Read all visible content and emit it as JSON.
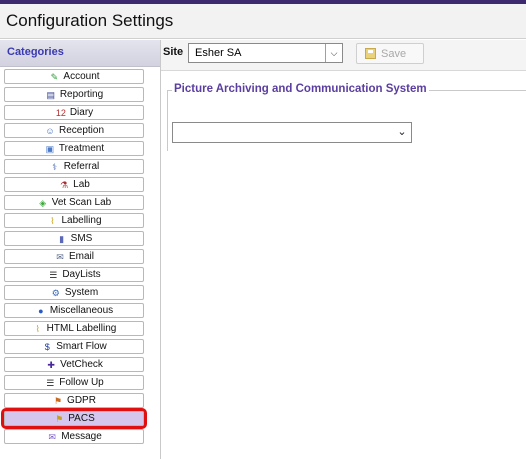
{
  "window": {
    "title": "Configuration Settings"
  },
  "sidebar": {
    "header": "Categories",
    "items": [
      {
        "label": "Account",
        "icon": "account-icon",
        "glyph": "✎",
        "color": "#2e9a3a"
      },
      {
        "label": "Reporting",
        "icon": "reporting-icon",
        "glyph": "▤",
        "color": "#2e3f8f"
      },
      {
        "label": "Diary",
        "icon": "diary-icon",
        "glyph": "12",
        "color": "#b23030"
      },
      {
        "label": "Reception",
        "icon": "reception-icon",
        "glyph": "☺",
        "color": "#3c6cc0"
      },
      {
        "label": "Treatment",
        "icon": "treatment-icon",
        "glyph": "▣",
        "color": "#4a7ac8"
      },
      {
        "label": "Referral",
        "icon": "referral-icon",
        "glyph": "⚕",
        "color": "#3c5cb0"
      },
      {
        "label": "Lab",
        "icon": "lab-icon",
        "glyph": "⚗",
        "color": "#a83030"
      },
      {
        "label": "Vet Scan Lab",
        "icon": "vet-scan-lab-icon",
        "glyph": "◈",
        "color": "#3ca83c"
      },
      {
        "label": "Labelling",
        "icon": "labelling-icon",
        "glyph": "⌇",
        "color": "#c8a020"
      },
      {
        "label": "SMS",
        "icon": "sms-icon",
        "glyph": "▮",
        "color": "#5a6ab8"
      },
      {
        "label": "Email",
        "icon": "email-icon",
        "glyph": "✉",
        "color": "#5a6a8a"
      },
      {
        "label": "DayLists",
        "icon": "daylists-icon",
        "glyph": "☰",
        "color": "#2a2a2a"
      },
      {
        "label": "System",
        "icon": "system-icon",
        "glyph": "⚙",
        "color": "#3a6ab8"
      },
      {
        "label": "Miscellaneous",
        "icon": "miscellaneous-icon",
        "glyph": "●",
        "color": "#2a5ac8"
      },
      {
        "label": "HTML Labelling",
        "icon": "html-labelling-icon",
        "glyph": "⌇",
        "color": "#c8a020"
      },
      {
        "label": "Smart Flow",
        "icon": "smart-flow-icon",
        "glyph": "$",
        "color": "#1a3a9a"
      },
      {
        "label": "VetCheck",
        "icon": "vetcheck-icon",
        "glyph": "✚",
        "color": "#4a2a9a"
      },
      {
        "label": "Follow Up",
        "icon": "follow-up-icon",
        "glyph": "☰",
        "color": "#2a2a2a"
      },
      {
        "label": "GDPR",
        "icon": "gdpr-icon",
        "glyph": "⚑",
        "color": "#c86a20"
      },
      {
        "label": "PACS",
        "icon": "pacs-icon",
        "glyph": "⚑",
        "color": "#c8a020",
        "selected": true
      },
      {
        "label": "Message",
        "icon": "message-icon",
        "glyph": "✉",
        "color": "#7a5ac8"
      }
    ]
  },
  "toolbar": {
    "site_label": "Site",
    "site_value": "Esher SA",
    "save_label": "Save"
  },
  "main": {
    "section_title": "Picture Archiving and Communication System",
    "pacs_select_value": ""
  },
  "colors": {
    "accent_purple": "#5a3ea0",
    "selection_bg": "#d4c6ec",
    "selection_outline": "#e01010"
  }
}
